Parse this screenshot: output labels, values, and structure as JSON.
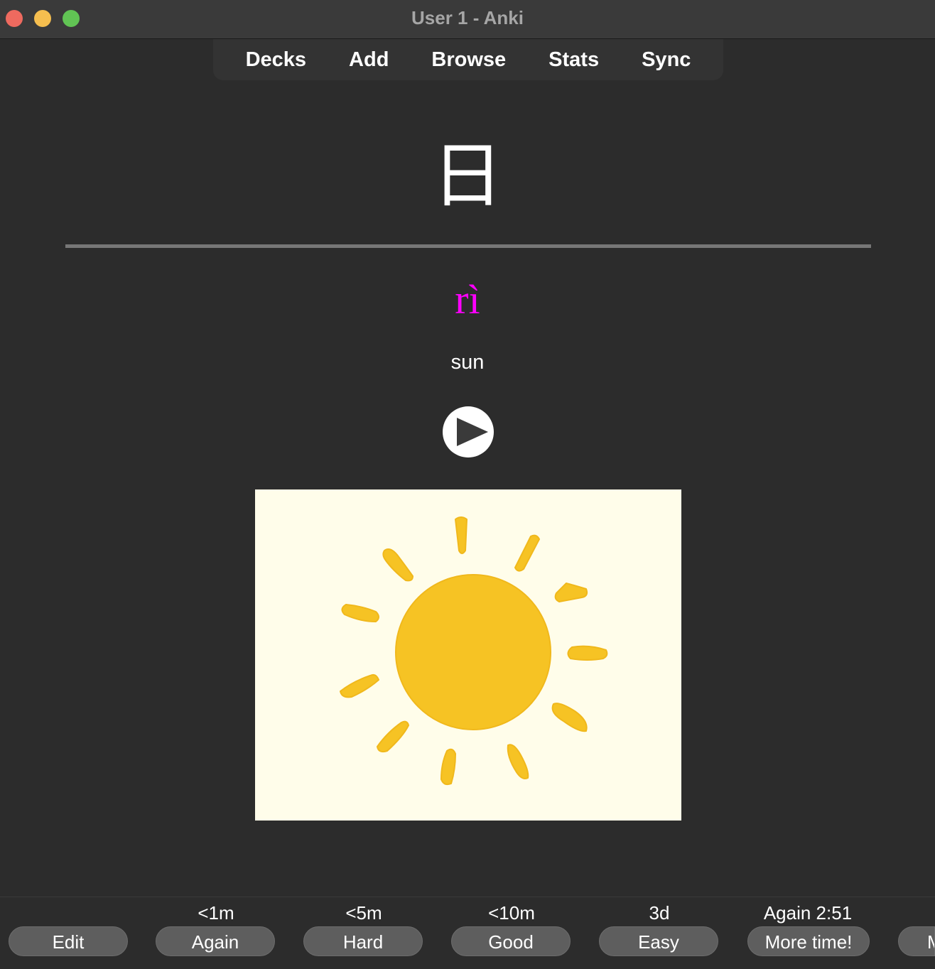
{
  "window": {
    "title": "User 1 - Anki"
  },
  "toolbar": {
    "items": [
      "Decks",
      "Add",
      "Browse",
      "Stats",
      "Sync"
    ]
  },
  "card": {
    "front": "日",
    "pinyin": "rì",
    "meaning": "sun",
    "colors": {
      "pinyin": "#ff00ff",
      "picture_background": "#fffdea",
      "sun": "#f6c324"
    },
    "audio_icon": "play-icon",
    "picture_icon": "sun-drawing"
  },
  "bottom": {
    "edit_label": "Edit",
    "answers": [
      {
        "due": "<1m",
        "label": "Again"
      },
      {
        "due": "<5m",
        "label": "Hard"
      },
      {
        "due": "<10m",
        "label": "Good"
      },
      {
        "due": "3d",
        "label": "Easy"
      }
    ],
    "timer_due": "Again 2:51",
    "more_time_label": "More time!",
    "more_label": "M"
  }
}
